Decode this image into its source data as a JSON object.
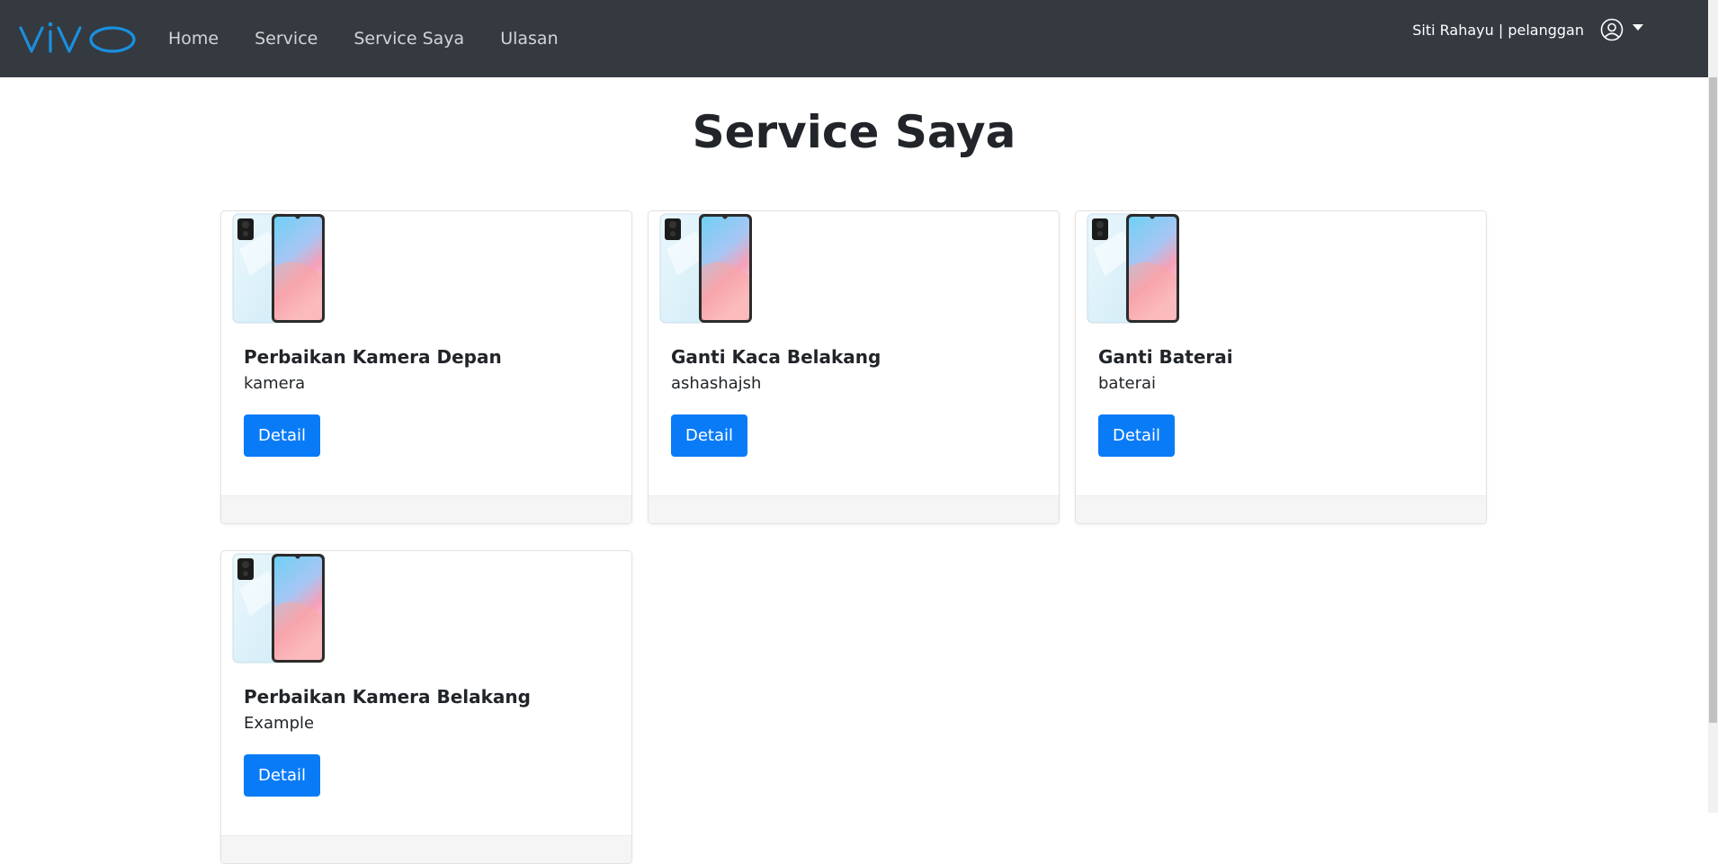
{
  "nav": {
    "brand": "vivo",
    "links": [
      "Home",
      "Service",
      "Service Saya",
      "Ulasan"
    ],
    "user": "Siti Rahayu | pelanggan"
  },
  "page": {
    "title": "Service Saya"
  },
  "cards": [
    {
      "title": "Perbaikan Kamera Depan",
      "text": "kamera",
      "button": "Detail"
    },
    {
      "title": "Ganti Kaca Belakang",
      "text": "ashashajsh",
      "button": "Detail"
    },
    {
      "title": "Ganti Baterai",
      "text": "baterai",
      "button": "Detail"
    },
    {
      "title": "Perbaikan Kamera Belakang",
      "text": "Example",
      "button": "Detail"
    }
  ],
  "colors": {
    "navbar": "#343a40",
    "brand": "#1a8fe0",
    "primary": "#0a7bf7"
  }
}
